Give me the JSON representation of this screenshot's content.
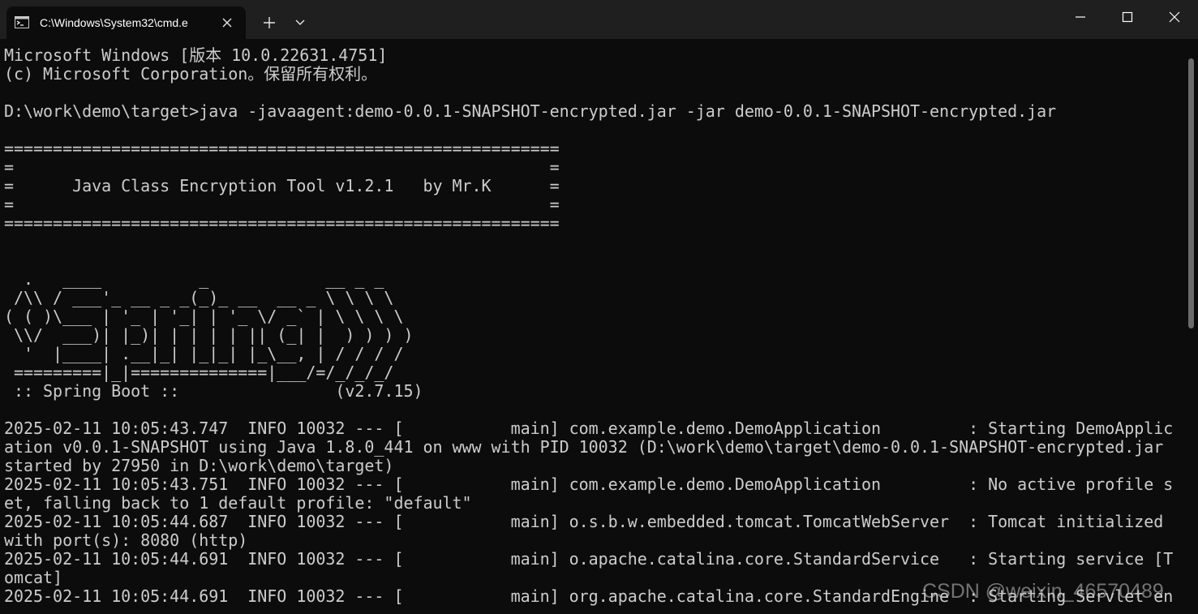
{
  "window": {
    "tab_title": "C:\\Windows\\System32\\cmd.e",
    "tab_icon": "terminal-icon",
    "new_tab_icon": "plus-icon",
    "dropdown_icon": "chevron-down-icon",
    "controls": [
      "minimize-icon",
      "maximize-icon",
      "close-icon"
    ]
  },
  "console": {
    "lines": [
      "Microsoft Windows [版本 10.0.22631.4751]",
      "(c) Microsoft Corporation。保留所有权利。",
      "",
      "D:\\work\\demo\\target>java -javaagent:demo-0.0.1-SNAPSHOT-encrypted.jar -jar demo-0.0.1-SNAPSHOT-encrypted.jar",
      "",
      "=========================================================",
      "=                                                       =",
      "=      Java Class Encryption Tool v1.2.1   by Mr.K      =",
      "=                                                       =",
      "=========================================================",
      "",
      "",
      "  .   ____          _            __ _ _",
      " /\\\\ / ___'_ __ _ _(_)_ __  __ _ \\ \\ \\ \\",
      "( ( )\\___ | '_ | '_| | '_ \\/ _` | \\ \\ \\ \\",
      " \\\\/  ___)| |_)| | | | | || (_| |  ) ) ) )",
      "  '  |____| .__|_| |_|_| |_\\__, | / / / /",
      " =========|_|==============|___/=/_/_/_/",
      " :: Spring Boot ::                (v2.7.15)",
      "",
      "2025-02-11 10:05:43.747  INFO 10032 --- [           main] com.example.demo.DemoApplication         : Starting DemoApplic",
      "ation v0.0.1-SNAPSHOT using Java 1.8.0_441 on www with PID 10032 (D:\\work\\demo\\target\\demo-0.0.1-SNAPSHOT-encrypted.jar",
      "started by 27950 in D:\\work\\demo\\target)",
      "2025-02-11 10:05:43.751  INFO 10032 --- [           main] com.example.demo.DemoApplication         : No active profile s",
      "et, falling back to 1 default profile: \"default\"",
      "2025-02-11 10:05:44.687  INFO 10032 --- [           main] o.s.b.w.embedded.tomcat.TomcatWebServer  : Tomcat initialized",
      "with port(s): 8080 (http)",
      "2025-02-11 10:05:44.691  INFO 10032 --- [           main] o.apache.catalina.core.StandardService   : Starting service [T",
      "omcat]",
      "2025-02-11 10:05:44.691  INFO 10032 --- [           main] org.apache.catalina.core.StandardEngine  : Starting Servlet en"
    ]
  },
  "watermark": "CSDN @weixin_46570489"
}
